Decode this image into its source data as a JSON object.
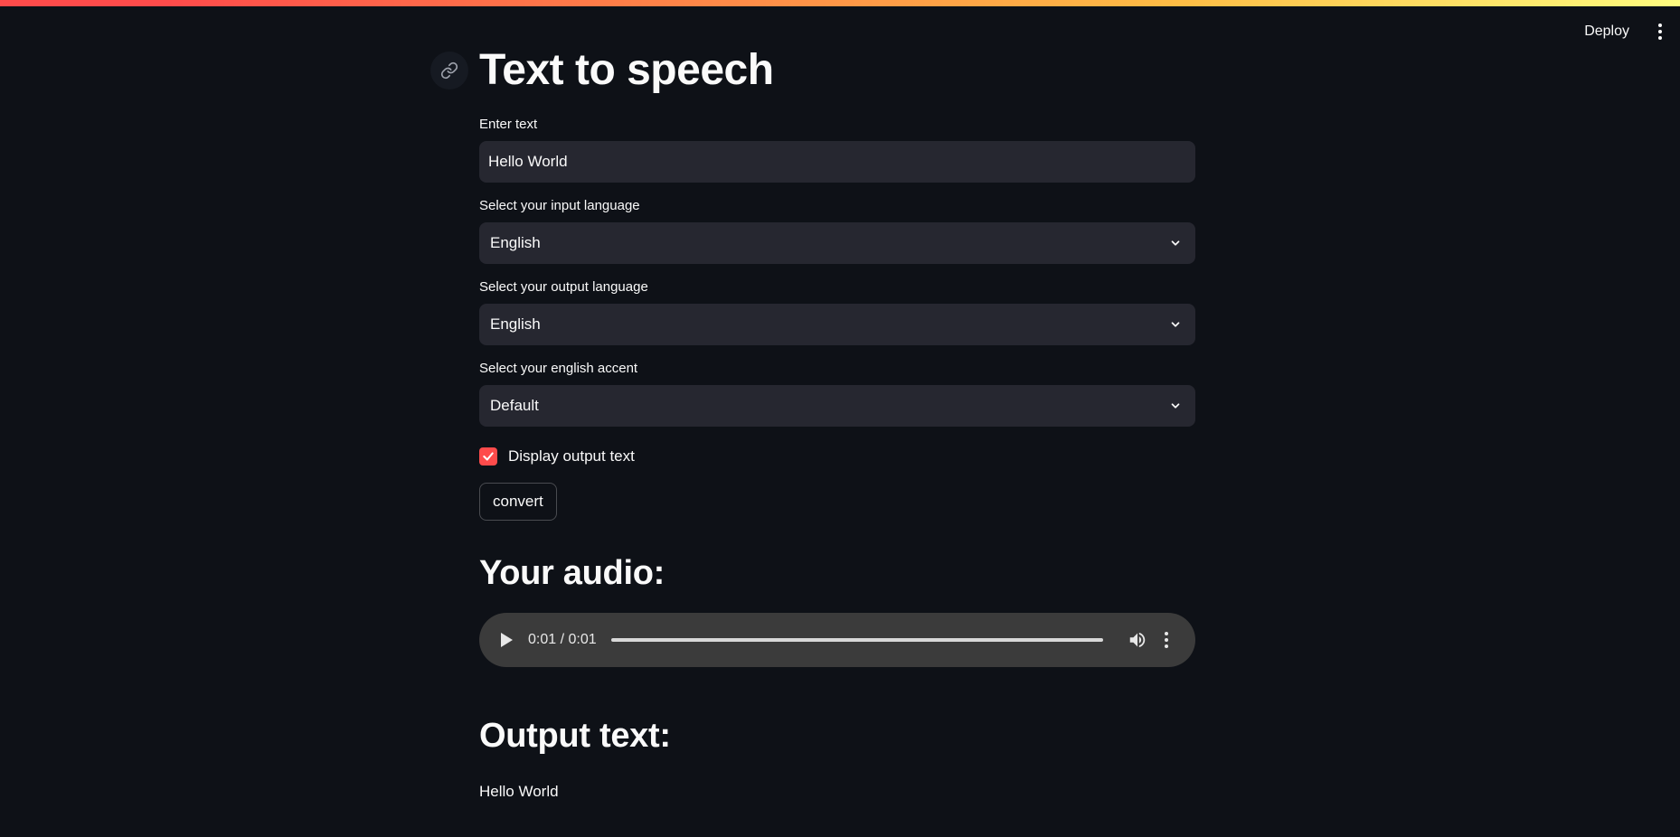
{
  "header": {
    "deploy_label": "Deploy",
    "menu_icon": "kebab-menu-icon"
  },
  "page": {
    "title": "Text to speech",
    "anchor_icon": "link-icon"
  },
  "form": {
    "text_input": {
      "label": "Enter text",
      "value": "Hello World"
    },
    "input_language": {
      "label": "Select your input language",
      "selected": "English"
    },
    "output_language": {
      "label": "Select your output language",
      "selected": "English"
    },
    "accent": {
      "label": "Select your english accent",
      "selected": "Default"
    },
    "display_output": {
      "label": "Display output text",
      "checked": true
    },
    "convert_label": "convert"
  },
  "audio_section": {
    "heading": "Your audio:",
    "time": "0:01 / 0:01",
    "progress": 1.0
  },
  "output_section": {
    "heading": "Output text:",
    "text": "Hello World"
  },
  "colors": {
    "background": "#0e1117",
    "input_bg": "#262730",
    "accent": "#ff4b4b",
    "audio_bg": "#3b3b3b"
  }
}
